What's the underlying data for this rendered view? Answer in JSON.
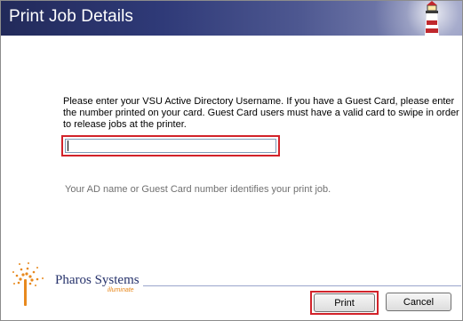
{
  "window": {
    "title": "Print Job Details"
  },
  "form": {
    "instructions": "Please enter your VSU Active Directory Username.  If you have a Guest Card, please enter the number printed on your card.  Guest Card users must have a valid card to swipe in order to release jobs at the printer.",
    "username_value": "",
    "hint": "Your AD name or Guest Card number identifies your print job."
  },
  "branding": {
    "name": "Pharos Systems",
    "tagline": "illuminate",
    "accent_color": "#e8891e",
    "brand_color": "#26326b"
  },
  "buttons": {
    "print_label": "Print",
    "cancel_label": "Cancel"
  },
  "highlight_color": "#d2232a"
}
